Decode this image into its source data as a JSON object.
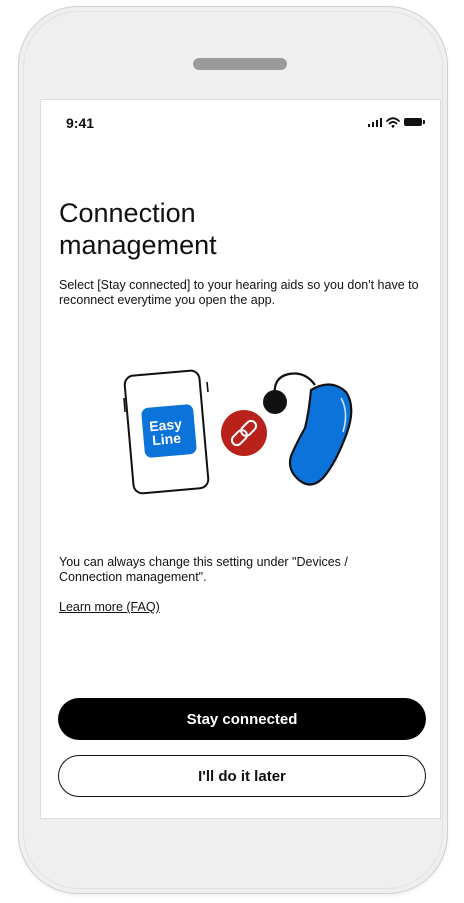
{
  "status_bar": {
    "time": "9:41"
  },
  "page": {
    "title_line1": "Connection",
    "title_line2": "management",
    "description": "Select [Stay connected] to your hearing aids so you don't have to reconnect everytime you open the app.",
    "note": "You can always change this setting under \"Devices / Connection management\".",
    "faq_link": "Learn more (FAQ)"
  },
  "illustration": {
    "app_badge_line1": "Easy",
    "app_badge_line2": "Line",
    "app_badge_color": "#0b73d9",
    "link_circle_color": "#b8221b",
    "hearing_aid_color": "#0b73d9",
    "icons": [
      "phone-icon",
      "link-icon",
      "hearing-aid-icon"
    ]
  },
  "buttons": {
    "primary": "Stay connected",
    "secondary": "I'll do it later"
  },
  "colors": {
    "primary_button_bg": "#000000",
    "frame_bg": "#efefef"
  }
}
